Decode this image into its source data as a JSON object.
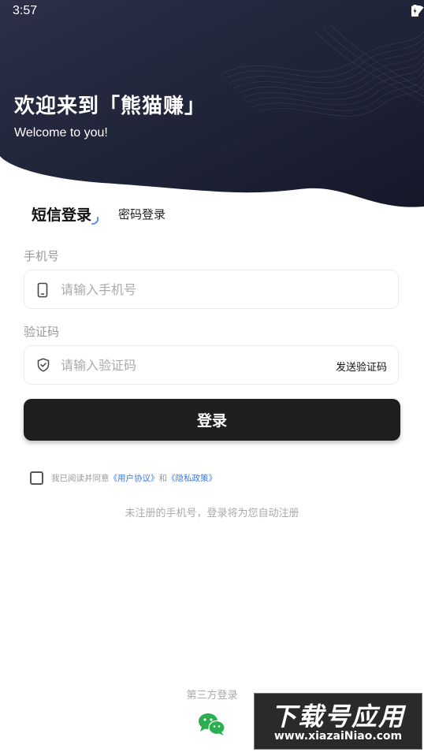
{
  "status": {
    "time": "3:57"
  },
  "hero": {
    "title": "欢迎来到「熊猫赚」",
    "subtitle": "Welcome to you!"
  },
  "tabs": [
    {
      "label": "短信登录",
      "active": true
    },
    {
      "label": "密码登录",
      "active": false
    }
  ],
  "form": {
    "phone_label": "手机号",
    "phone_placeholder": "请输入手机号",
    "phone_value": "",
    "code_label": "验证码",
    "code_placeholder": "请输入验证码",
    "code_value": "",
    "send_code_label": "发送验证码",
    "submit_label": "登录"
  },
  "agreement": {
    "checked": false,
    "prefix": "我已阅读并同意",
    "user_agreement": "《用户协议》",
    "and": "和",
    "privacy_policy": "《隐私政策》"
  },
  "auto_register_note": "未注册的手机号，登录将为您自动注册",
  "third_party": {
    "title": "第三方登录",
    "icon": "wechat-icon"
  },
  "watermark": {
    "title": "下载号应用",
    "url": "www.xiazaiNiao.com"
  },
  "colors": {
    "hero_bg": "#1f2337",
    "accent": "#3d7bd9",
    "button": "#1e1e1e",
    "wechat": "#2bae4f"
  }
}
